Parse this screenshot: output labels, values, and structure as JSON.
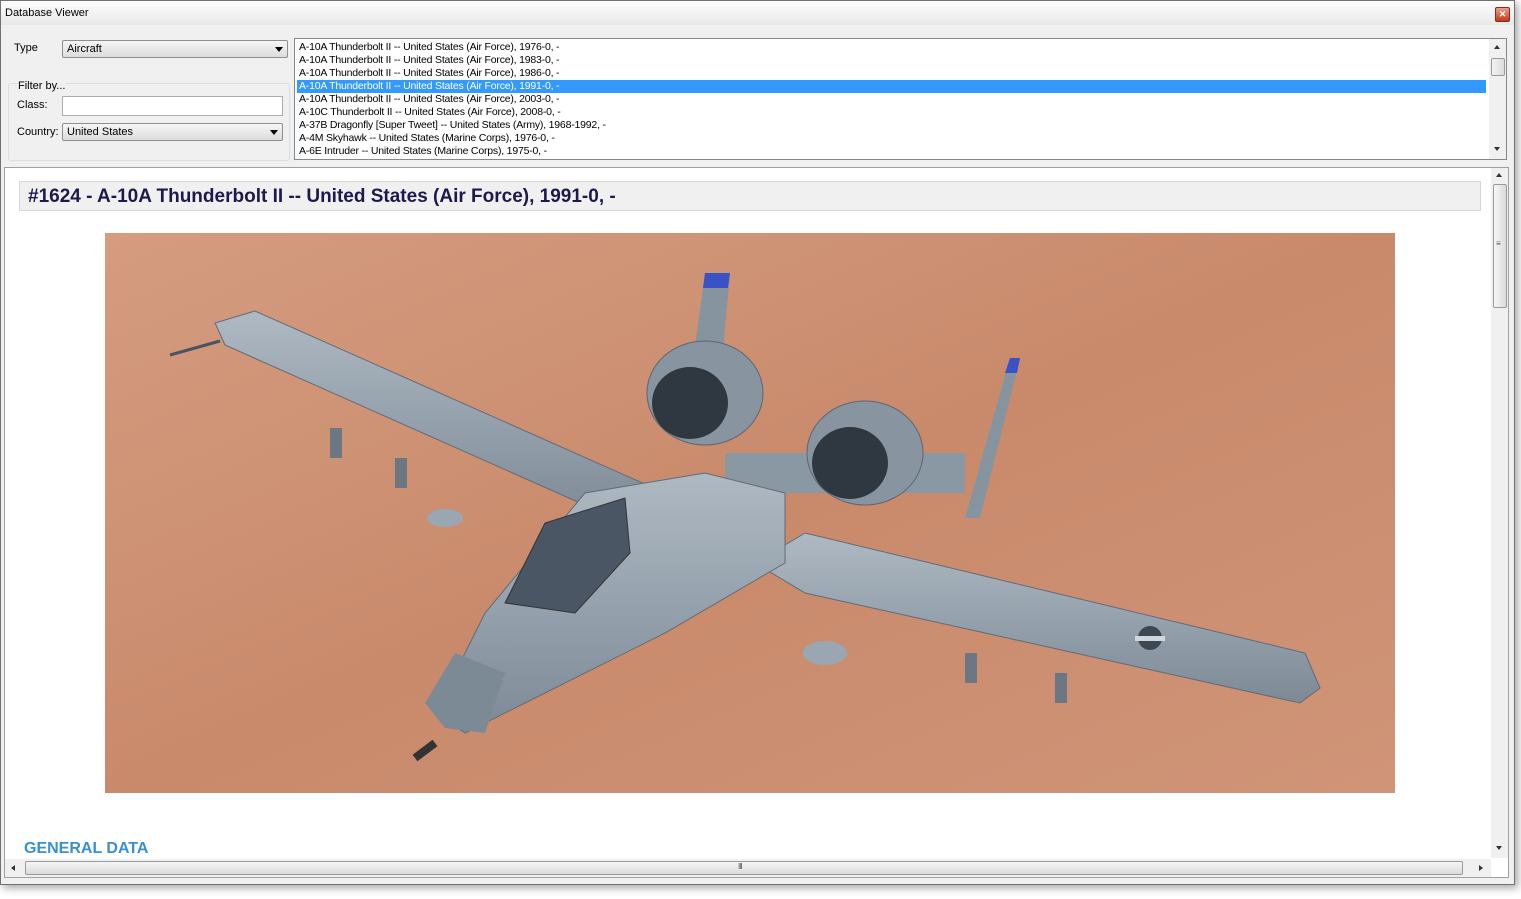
{
  "window": {
    "title": "Database Viewer",
    "close_glyph": "✕"
  },
  "filters": {
    "type_label": "Type",
    "type_value": "Aircraft",
    "filter_by_label": "Filter by...",
    "class_label": "Class:",
    "class_value": "",
    "country_label": "Country:",
    "country_value": "United States"
  },
  "list": {
    "items": [
      "A-10A Thunderbolt II -- United States (Air Force), 1976-0, -",
      "A-10A Thunderbolt II -- United States (Air Force), 1983-0, -",
      "A-10A Thunderbolt II -- United States (Air Force), 1986-0, -",
      "A-10A Thunderbolt II -- United States (Air Force), 1991-0, -",
      "A-10A Thunderbolt II -- United States (Air Force), 2003-0, -",
      "A-10C Thunderbolt II -- United States (Air Force), 2008-0, -",
      "A-37B Dragonfly [Super Tweet] -- United States (Army), 1968-1992, -",
      "A-4M Skyhawk -- United States (Marine Corps), 1976-0, -",
      "A-6E Intruder -- United States (Marine Corps), 1975-0, -"
    ],
    "selected_index": 3
  },
  "detail": {
    "heading": "#1624 - A-10A Thunderbolt II -- United States (Air Force), 1991-0, -",
    "section_title": "GENERAL DATA",
    "h_scroll_grip": "III",
    "v_scroll_grip": "≡"
  },
  "colors": {
    "selection": "#3399ff",
    "heading_text": "#1a1a4e",
    "section_text": "#3a8fd0",
    "desert": "#c98a6b",
    "aircraft": "#8a99a6"
  },
  "icons": [
    "close-icon",
    "combo-arrow-icon",
    "scroll-up-icon",
    "scroll-down-icon",
    "scroll-left-icon",
    "scroll-right-icon"
  ]
}
